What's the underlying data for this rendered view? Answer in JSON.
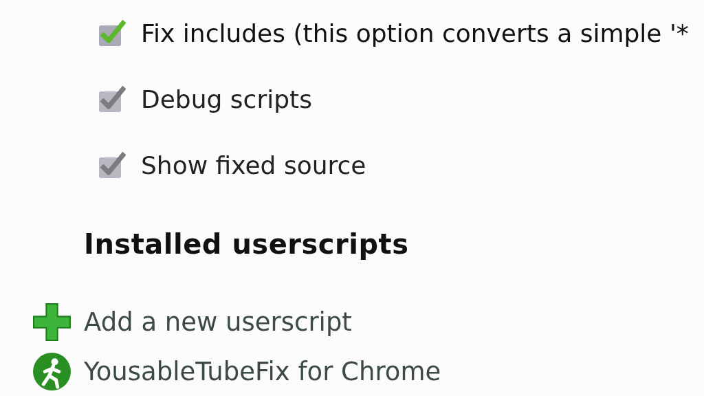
{
  "options": [
    {
      "label": "Fix includes (this option converts a simple '*",
      "checked": true,
      "disabled": false
    },
    {
      "label": "Debug scripts",
      "checked": true,
      "disabled": true
    },
    {
      "label": "Show fixed source",
      "checked": true,
      "disabled": true
    }
  ],
  "section": {
    "title": "Installed userscripts"
  },
  "actions": [
    {
      "kind": "add",
      "label": "Add a new userscript"
    },
    {
      "kind": "script",
      "label": "YousableTubeFix for Chrome"
    }
  ]
}
